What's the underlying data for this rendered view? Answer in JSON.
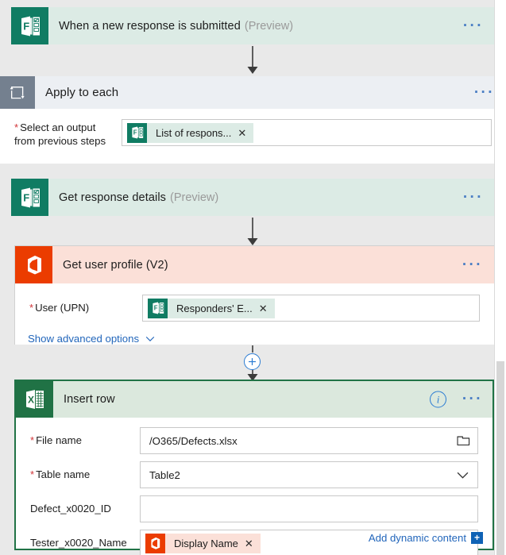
{
  "flow": {
    "trigger": {
      "title": "When a new response is submitted",
      "badge": "(Preview)",
      "icon": "microsoft-forms-icon",
      "menu": "···"
    },
    "apply_to_each": {
      "title": "Apply to each",
      "icon": "loop-icon",
      "menu": "···",
      "field": {
        "label_line1": "Select an output",
        "label_line2": "from previous steps",
        "required_marker": "*",
        "token": {
          "label": "List of respons...",
          "remove": "✕",
          "icon": "microsoft-forms-icon"
        }
      }
    },
    "get_response_details": {
      "title": "Get response details",
      "badge": "(Preview)",
      "icon": "microsoft-forms-icon",
      "menu": "···"
    },
    "get_user_profile": {
      "title": "Get user profile (V2)",
      "icon": "office-365-icon",
      "menu": "···",
      "field": {
        "label": "User (UPN)",
        "required_marker": "*",
        "token": {
          "label": "Responders' E...",
          "remove": "✕",
          "icon": "microsoft-forms-icon"
        }
      },
      "advanced_link": "Show advanced options",
      "advanced_chevron": "⌄"
    },
    "insert_row": {
      "title": "Insert row",
      "icon": "excel-icon",
      "info": "i",
      "menu": "···",
      "fields": [
        {
          "label": "File name",
          "required_marker": "*",
          "value": "/O365/Defects.xlsx",
          "trailing_icon": "folder-icon"
        },
        {
          "label": "Table name",
          "required_marker": "*",
          "value": "Table2",
          "trailing_icon": "chevron-down-icon"
        },
        {
          "label": "Defect_x0020_ID",
          "required_marker": "",
          "value": "",
          "trailing_icon": ""
        },
        {
          "label": "Tester_x0020_Name",
          "required_marker": "",
          "value": "",
          "trailing_icon": "",
          "token": {
            "label": "Display Name",
            "remove": "✕",
            "icon": "office-365-icon"
          }
        }
      ],
      "add_dynamic_content": "Add dynamic content",
      "add_dynamic_plus": "+"
    },
    "insert_step_button": "+"
  },
  "colors": {
    "forms_teal": "#107c63",
    "forms_header": "#dcebe5",
    "office_orange": "#eb3c00",
    "office_header": "#fbe0d8",
    "excel_green": "#207245",
    "excel_header": "#dbe8dd",
    "loop_gray": "#74808f",
    "link_blue": "#2266bb",
    "required_red": "#d13438",
    "selection_green": "#217346"
  }
}
